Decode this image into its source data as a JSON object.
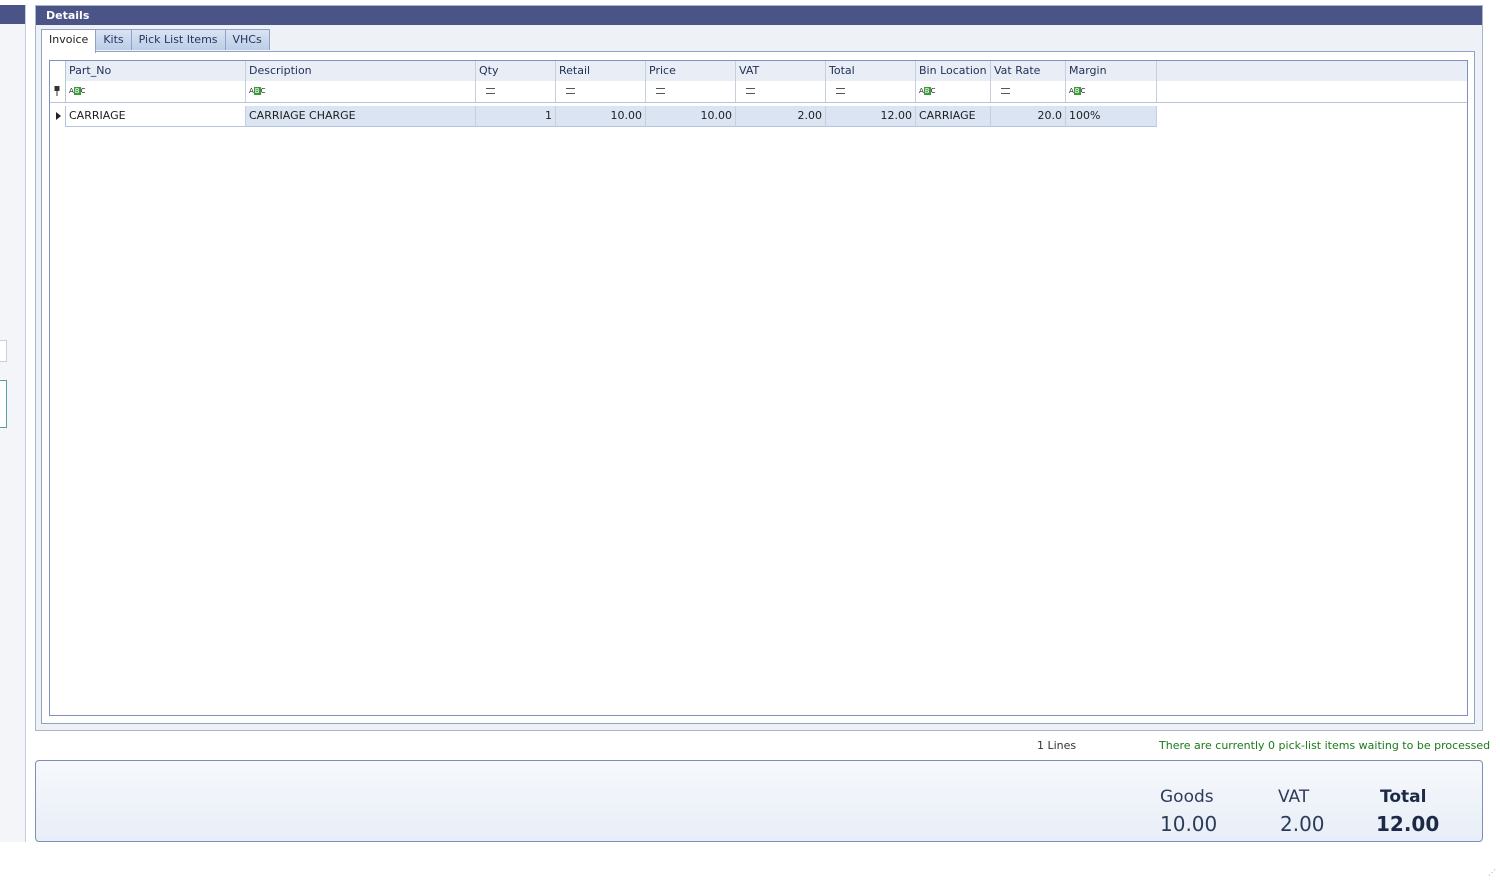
{
  "panel": {
    "title": "Details"
  },
  "tabs": [
    {
      "label": "Invoice",
      "active": true
    },
    {
      "label": "Kits",
      "active": false
    },
    {
      "label": "Pick List Items",
      "active": false
    },
    {
      "label": "VHCs",
      "active": false
    }
  ],
  "grid": {
    "columns": [
      "Part_No",
      "Description",
      "Qty",
      "Retail",
      "Price",
      "VAT",
      "Total",
      "Bin Location",
      "Vat Rate",
      "Margin"
    ],
    "filter_types": [
      "text",
      "text",
      "numeric",
      "numeric",
      "numeric",
      "numeric",
      "numeric",
      "text",
      "numeric",
      "text"
    ],
    "rows": [
      {
        "part_no": "CARRIAGE",
        "description": "CARRIAGE CHARGE",
        "qty": "1",
        "retail": "10.00",
        "price": "10.00",
        "vat": "2.00",
        "total": "12.00",
        "bin_location": "CARRIAGE",
        "vat_rate": "20.0",
        "margin": "100%"
      }
    ]
  },
  "status": {
    "lines": "1 Lines",
    "picklist_message": "There are currently 0 pick-list items waiting to be processed"
  },
  "totals": {
    "goods_label": "Goods",
    "goods_value": "10.00",
    "vat_label": "VAT",
    "vat_value": "2.00",
    "total_label": "Total",
    "total_value": "12.00"
  },
  "icons": {
    "filter_row": "pin-icon",
    "text_filter": "abc-icon",
    "numeric_filter": "equals-icon",
    "current_row": "row-arrow-icon"
  },
  "colors": {
    "header_bar": "#4b5486",
    "selected_row": "#dbe4f3",
    "status_green": "#1b7a1b"
  }
}
